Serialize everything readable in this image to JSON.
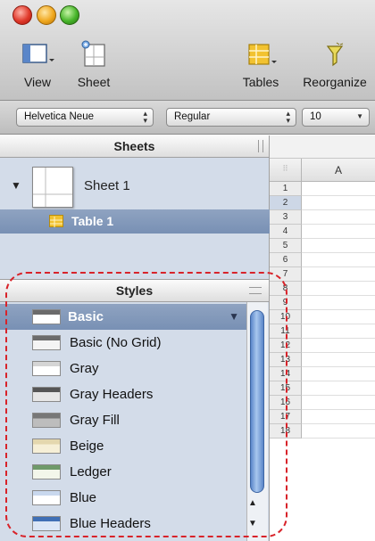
{
  "toolbar": {
    "buttons": [
      {
        "label": "View",
        "icon": "view-icon"
      },
      {
        "label": "Sheet",
        "icon": "sheet-icon"
      },
      {
        "label": "Tables",
        "icon": "tables-icon"
      },
      {
        "label": "Reorganize",
        "icon": "reorganize-icon"
      }
    ]
  },
  "format_bar": {
    "font_family": "Helvetica Neue",
    "font_style": "Regular",
    "font_size": "10"
  },
  "sheets_panel": {
    "title": "Sheets",
    "sheet": "Sheet 1",
    "table": "Table 1"
  },
  "styles_panel": {
    "title": "Styles",
    "selected_index": 0,
    "items": [
      {
        "label": "Basic",
        "swatch_header": "#6b6b6b",
        "swatch_body": "#ffffff"
      },
      {
        "label": "Basic (No Grid)",
        "swatch_header": "#6b6b6b",
        "swatch_body": "#f4f4f4"
      },
      {
        "label": "Gray",
        "swatch_header": "#d5d5d5",
        "swatch_body": "#ffffff"
      },
      {
        "label": "Gray Headers",
        "swatch_header": "#555555",
        "swatch_body": "#e6e6e6"
      },
      {
        "label": "Gray Fill",
        "swatch_header": "#777777",
        "swatch_body": "#bdbdbd"
      },
      {
        "label": "Beige",
        "swatch_header": "#e4d7ae",
        "swatch_body": "#f6efd7"
      },
      {
        "label": "Ledger",
        "swatch_header": "#6f9a6a",
        "swatch_body": "#f3f6ea"
      },
      {
        "label": "Blue",
        "swatch_header": "#c9d8ee",
        "swatch_body": "#ffffff"
      },
      {
        "label": "Blue Headers",
        "swatch_header": "#3f6fb5",
        "swatch_body": "#dbe6f6"
      }
    ]
  },
  "grid": {
    "column_header": "A",
    "rows": [
      "1",
      "2",
      "3",
      "4",
      "5",
      "6",
      "7",
      "8",
      "9",
      "10",
      "11",
      "12",
      "13",
      "14",
      "15",
      "16",
      "17",
      "18"
    ],
    "selected_row": "2"
  },
  "highlight_color": "#d8232a"
}
